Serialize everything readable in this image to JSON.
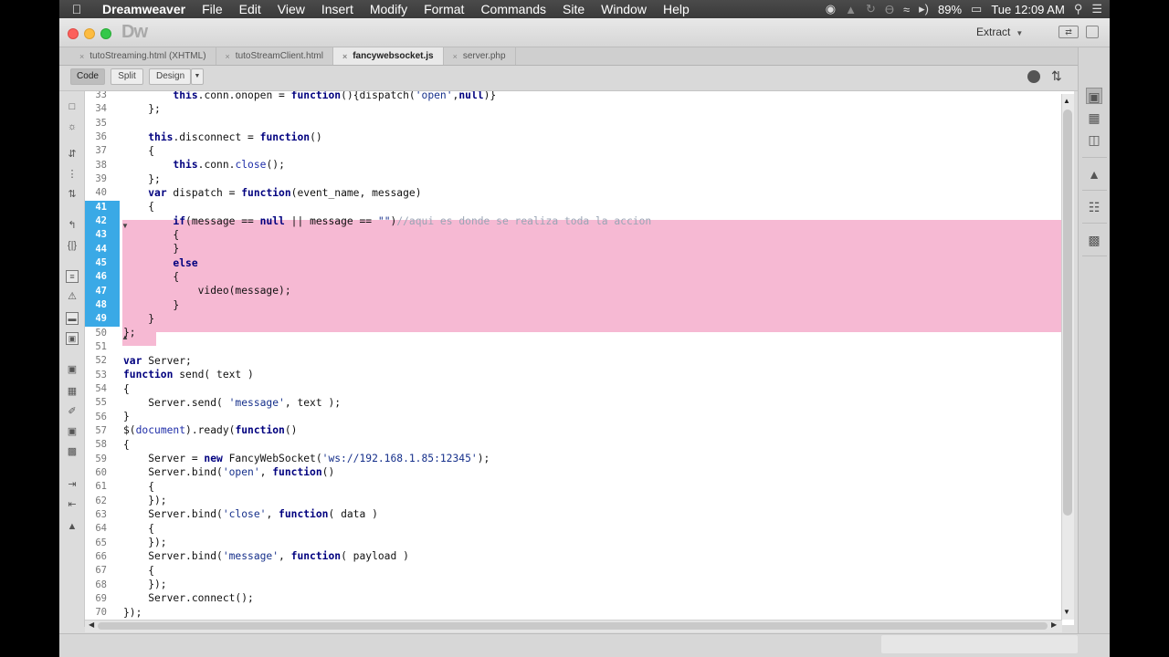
{
  "menubar": {
    "app_name": "Dreamweaver",
    "menus": [
      "File",
      "Edit",
      "View",
      "Insert",
      "Modify",
      "Format",
      "Commands",
      "Site",
      "Window",
      "Help"
    ],
    "battery": "89%",
    "clock": "Tue 12:09 AM"
  },
  "window": {
    "logo": "Dw",
    "workspace": "Extract"
  },
  "tabs": [
    {
      "label": "tutoStreaming.html (XHTML)",
      "active": false
    },
    {
      "label": "tutoStreamClient.html",
      "active": false
    },
    {
      "label": "fancywebsocket.js",
      "active": true
    },
    {
      "label": "server.php",
      "active": false
    }
  ],
  "views": {
    "code": "Code",
    "split": "Split",
    "design": "Design"
  },
  "code": {
    "line_numbers": [
      "33",
      "34",
      "35",
      "36",
      "37",
      "38",
      "39",
      "40",
      "41",
      "42",
      "43",
      "44",
      "45",
      "46",
      "47",
      "48",
      "49",
      "50",
      "51",
      "52",
      "53",
      "54",
      "55",
      "56",
      "57",
      "58",
      "59",
      "60",
      "61",
      "62",
      "63",
      "64",
      "65",
      "66",
      "67",
      "68",
      "69",
      "70"
    ],
    "selected_lines": [
      41,
      49
    ],
    "l33a": "        ",
    "l33b": "this",
    "l33c": ".conn.onopen = ",
    "l33d": "function",
    "l33e": "(){dispatch(",
    "l33f": "'open'",
    "l33g": ",",
    "l33h": "null",
    "l33i": ")}",
    "l34": "    };",
    "l36a": "    ",
    "l36b": "this",
    "l36c": ".disconnect = ",
    "l36d": "function",
    "l36e": "()",
    "l37": "    {",
    "l38a": "        ",
    "l38b": "this",
    "l38c": ".conn.",
    "l38d": "close",
    "l38e": "();",
    "l39": "    };",
    "l40a": "    ",
    "l40b": "var",
    "l40c": " dispatch = ",
    "l40d": "function",
    "l40e": "(event_name, message)",
    "l41": "    {",
    "l42a": "        ",
    "l42b": "if",
    "l42c": "(message == ",
    "l42d": "null",
    "l42e": " || message == ",
    "l42f": "\"\"",
    "l42g": ")",
    "l42h": "//aqui es donde se realiza toda la accion",
    "l43": "        {",
    "l44": "        }",
    "l45a": "        ",
    "l45b": "else",
    "l46": "        {",
    "l47": "            video(message);",
    "l48": "        }",
    "l49": "    }",
    "l50": "};",
    "l52a": "var",
    "l52b": " Server;",
    "l53a": "function",
    "l53b": " send( text )",
    "l54": "{",
    "l55a": "    Server.send( ",
    "l55b": "'message'",
    "l55c": ", text );",
    "l56": "}",
    "l57a": "$(",
    "l57b": "document",
    "l57c": ").ready(",
    "l57d": "function",
    "l57e": "()",
    "l58": "{",
    "l59a": "    Server = ",
    "l59b": "new",
    "l59c": " FancyWebSocket(",
    "l59d": "'ws://192.168.1.85:12345'",
    "l59e": ");",
    "l60a": "    Server.bind(",
    "l60b": "'open'",
    "l60c": ", ",
    "l60d": "function",
    "l60e": "()",
    "l61": "    {",
    "l62": "    });",
    "l63a": "    Server.bind(",
    "l63b": "'close'",
    "l63c": ", ",
    "l63d": "function",
    "l63e": "( data )",
    "l64": "    {",
    "l65": "    });",
    "l66a": "    Server.bind(",
    "l66b": "'message'",
    "l66c": ", ",
    "l66d": "function",
    "l66e": "( payload )",
    "l67": "    {",
    "l68": "    });",
    "l69": "    Server.connect();",
    "l70": "});"
  },
  "colors": {
    "selection": "#f6b9d3",
    "gutter_selection": "#3aa9e6",
    "keyword": "#00007f",
    "string": "#16308b",
    "comment": "#9aa5b5"
  }
}
